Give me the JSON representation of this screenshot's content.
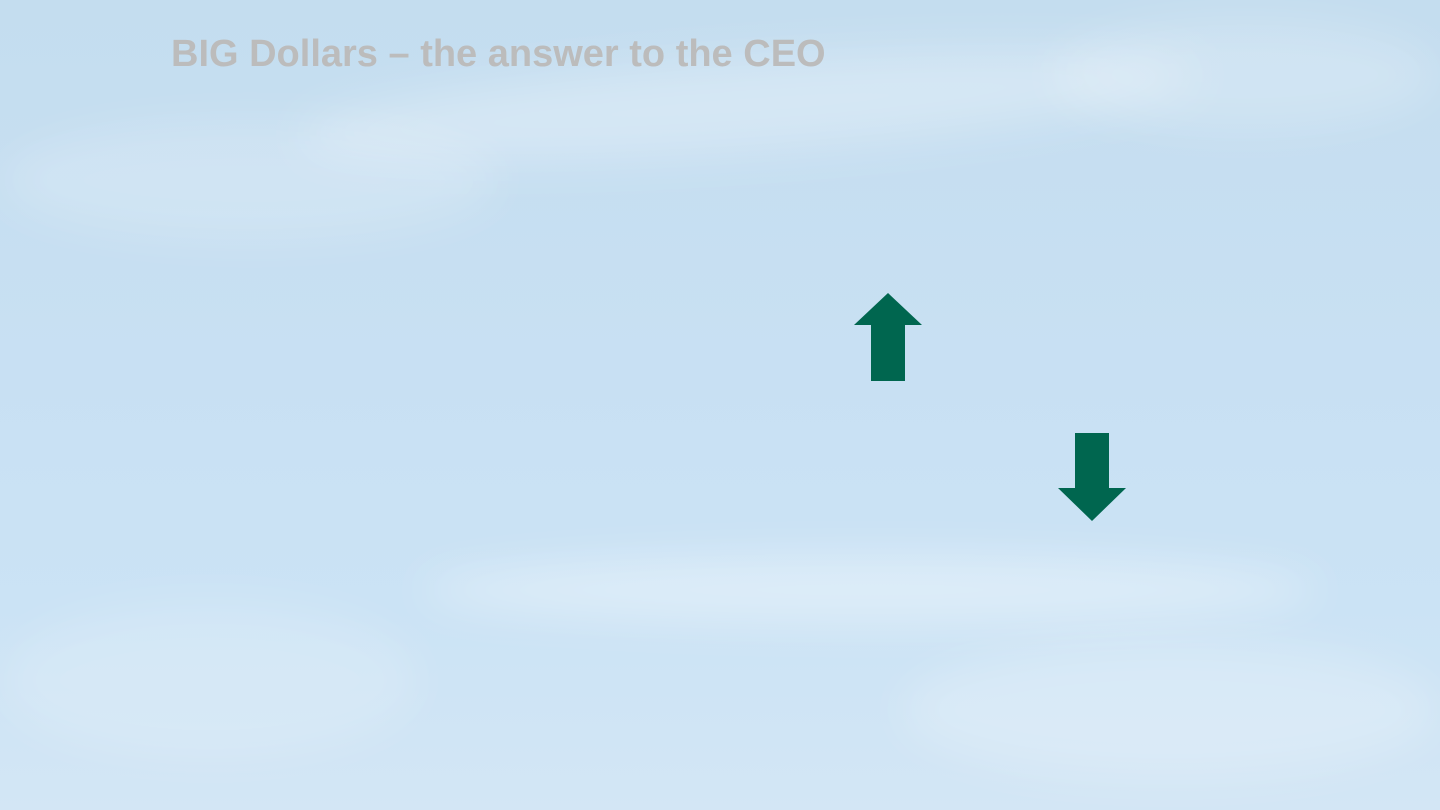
{
  "slide": {
    "title": "BIG Dollars – the answer to the CEO",
    "background": "sky-with-light-clouds",
    "colors": {
      "background": "#c8e0f3",
      "title_text": "#bcbcbc",
      "arrow_fill": "#00664f"
    },
    "icons": {
      "up": "arrow-up-icon",
      "down": "arrow-down-icon"
    }
  }
}
